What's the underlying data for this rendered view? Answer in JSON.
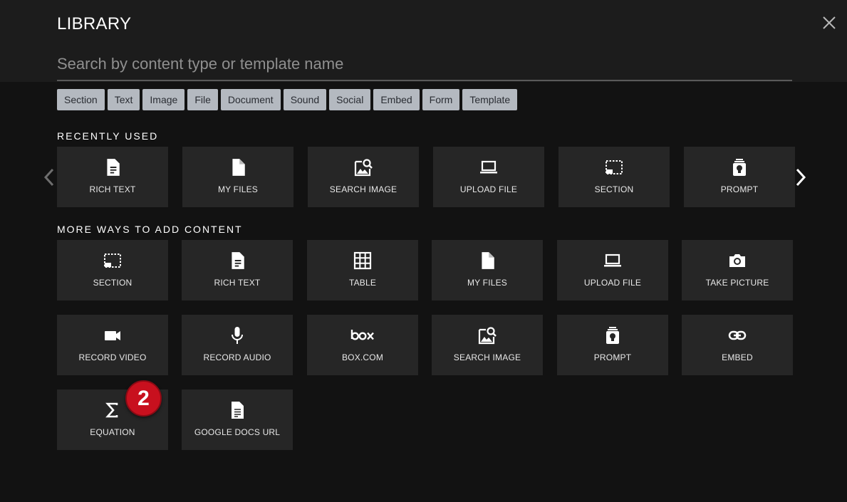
{
  "header": {
    "title": "LIBRARY",
    "search_placeholder": "Search by content type or template name",
    "search_value": ""
  },
  "filters": [
    "Section",
    "Text",
    "Image",
    "File",
    "Document",
    "Sound",
    "Social",
    "Embed",
    "Form",
    "Template"
  ],
  "recently_used": {
    "heading": "RECENTLY USED",
    "items": [
      {
        "label": "RICH TEXT",
        "icon": "document-icon"
      },
      {
        "label": "MY FILES",
        "icon": "file-icon"
      },
      {
        "label": "SEARCH IMAGE",
        "icon": "image-search-icon"
      },
      {
        "label": "UPLOAD FILE",
        "icon": "laptop-icon"
      },
      {
        "label": "SECTION",
        "icon": "section-icon"
      },
      {
        "label": "PROMPT",
        "icon": "prompt-icon"
      }
    ]
  },
  "more_ways": {
    "heading": "MORE WAYS TO ADD CONTENT",
    "items": [
      {
        "label": "SECTION",
        "icon": "section-icon"
      },
      {
        "label": "RICH TEXT",
        "icon": "document-icon"
      },
      {
        "label": "TABLE",
        "icon": "table-icon"
      },
      {
        "label": "MY FILES",
        "icon": "file-icon"
      },
      {
        "label": "UPLOAD FILE",
        "icon": "laptop-icon"
      },
      {
        "label": "TAKE PICTURE",
        "icon": "camera-icon"
      },
      {
        "label": "RECORD VIDEO",
        "icon": "video-camera-icon"
      },
      {
        "label": "RECORD AUDIO",
        "icon": "microphone-icon"
      },
      {
        "label": "BOX.COM",
        "icon": "box-logo-icon"
      },
      {
        "label": "SEARCH IMAGE",
        "icon": "image-search-icon"
      },
      {
        "label": "PROMPT",
        "icon": "prompt-icon"
      },
      {
        "label": "EMBED",
        "icon": "link-icon"
      },
      {
        "label": "EQUATION",
        "icon": "sigma-icon"
      },
      {
        "label": "GOOGLE DOCS URL",
        "icon": "google-doc-icon"
      }
    ]
  },
  "step_badge": "2",
  "colors": {
    "background": "#121212",
    "header": "#1c1c1c",
    "tile": "#262626",
    "chip": "#b4b9c0",
    "badge": "#c8101e"
  }
}
